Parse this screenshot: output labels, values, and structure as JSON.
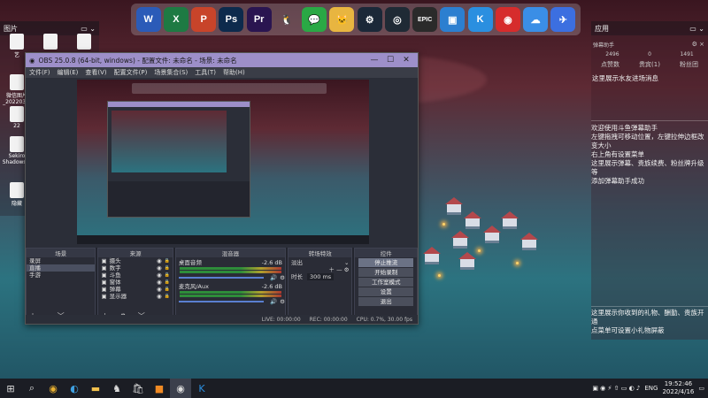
{
  "colors": {
    "accent": "#9d8fc9",
    "obs_bg": "#2b2e38",
    "taskbar": "#1b1d24"
  },
  "dock_icons": [
    {
      "name": "word-icon",
      "glyph": "W",
      "color": "#2b5bb8"
    },
    {
      "name": "excel-icon",
      "glyph": "X",
      "color": "#1e7a43"
    },
    {
      "name": "powerpoint-icon",
      "glyph": "P",
      "color": "#c8442a"
    },
    {
      "name": "photoshop-icon",
      "glyph": "Ps",
      "color": "#0d2a4c"
    },
    {
      "name": "premiere-icon",
      "glyph": "Pr",
      "color": "#2a1550"
    },
    {
      "name": "qq-icon",
      "glyph": "🐧",
      "color": "transparent"
    },
    {
      "name": "wechat-icon",
      "glyph": "💬",
      "color": "#2aa845"
    },
    {
      "name": "mascot-icon",
      "glyph": "🐱",
      "color": "#e8b540"
    },
    {
      "name": "steam-icon",
      "glyph": "⚙",
      "color": "#1b2838"
    },
    {
      "name": "gamepad-icon",
      "glyph": "◎",
      "color": "#1f2a35"
    },
    {
      "name": "epic-games-icon",
      "glyph": "EPIC",
      "color": "#2a2a2a"
    },
    {
      "name": "capture-icon",
      "glyph": "▣",
      "color": "#2c7fd0"
    },
    {
      "name": "k-app-icon",
      "glyph": "K",
      "color": "#2a8fe0"
    },
    {
      "name": "netease-music-icon",
      "glyph": "◉",
      "color": "#d62c2c"
    },
    {
      "name": "baidu-netdisk-icon",
      "glyph": "☁",
      "color": "#3a8ee6"
    },
    {
      "name": "feishu-icon",
      "glyph": "✈",
      "color": "#3c6fe0"
    }
  ],
  "left_fence": {
    "title": "图片",
    "icons": [
      {
        "label": "艺"
      },
      {
        "label": ""
      },
      {
        "label": ""
      },
      {
        "label": "微信图片_202203..."
      },
      {
        "label": "22"
      },
      {
        "label": "Sekiro Shadows..."
      },
      {
        "label": "隐藏"
      }
    ]
  },
  "right_fence": {
    "title": "应用",
    "owner": "弹幕助手",
    "stats": [
      "2496",
      "0",
      "1491"
    ],
    "stat_labels": [
      "点赞数",
      "贵宾(1)",
      "粉丝团"
    ],
    "msg_top": "这里展示水友进场消息",
    "msgs_mid": [
      "欢迎使用斗鱼弹幕助手",
      "左键拖拽可移动位置，左键拉伸边框改变大小",
      "右上角有设置菜单",
      "这里展示弹幕、贵族续费、粉丝牌升级等",
      "添加弹幕助手成功"
    ],
    "msgs_bottom": [
      "这里展示你收到的礼物、酬勤、贵族开通",
      "点菜单可设置小礼物屏蔽"
    ]
  },
  "obs": {
    "title": "OBS 25.0.8 (64-bit, windows) - 配置文件: 未命名 - 场景: 未命名",
    "menu": [
      "文件(F)",
      "编辑(E)",
      "查看(V)",
      "配置文件(P)",
      "场景集合(S)",
      "工具(T)",
      "帮助(H)"
    ],
    "scenes_title": "场景",
    "scenes": [
      "录屏",
      "直播",
      "手游"
    ],
    "sources_title": "来源",
    "sources": [
      "摄头",
      "数字",
      "斗鱼",
      "窗体",
      "弹幕",
      "显示器"
    ],
    "mixer_title": "混音器",
    "mixer": [
      {
        "name": "桌面音频",
        "db": "-2.6 dB"
      },
      {
        "name": "麦克风/Aux",
        "db": "-2.6 dB"
      }
    ],
    "transitions_title": "转场特效",
    "transition_type": "淡出",
    "duration_label": "时长",
    "duration_value": "300 ms",
    "controls_title": "控件",
    "controls": [
      "停止推流",
      "开始录制",
      "工作室模式",
      "设置",
      "退出"
    ],
    "status": {
      "live": "LIVE: 00:00:00",
      "rec": "REC: 00:00:00",
      "cpu": "CPU: 0.7%, 30.00 fps"
    }
  },
  "taskbar": {
    "time": "19:52:46",
    "date": "2022/4/16",
    "lang": "ENG"
  }
}
